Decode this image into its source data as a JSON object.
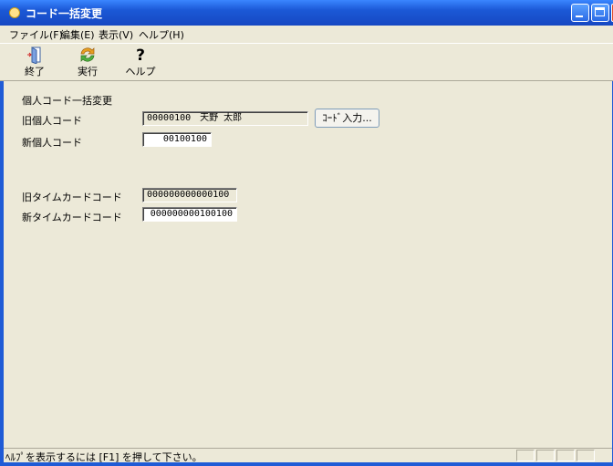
{
  "window": {
    "title": "コード一括変更"
  },
  "menu": [
    "ファイル(F)",
    "編集(E)",
    "表示(V)",
    "ヘルプ(H)"
  ],
  "toolbar": {
    "exit_label": "終了",
    "run_label": "実行",
    "help_label": "ヘルプ"
  },
  "form": {
    "section_title": "個人コード一括変更",
    "old_personal_label": "旧個人コード",
    "old_personal_value": "00000100　天野 太郎",
    "code_input_button": "ｺｰﾄﾞ入力...",
    "new_personal_label": "新個人コード",
    "new_personal_value": "00100100",
    "old_timecard_label": "旧タイムカードコード",
    "old_timecard_value": "000000000000100",
    "new_timecard_label": "新タイムカードコード",
    "new_timecard_value": "000000000100100"
  },
  "status": {
    "text": "ﾍﾙﾌﾟを表示するには [F1] を押して下さい。"
  },
  "colors": {
    "titlebar": "#1b58d6",
    "face": "#ece9d8"
  }
}
